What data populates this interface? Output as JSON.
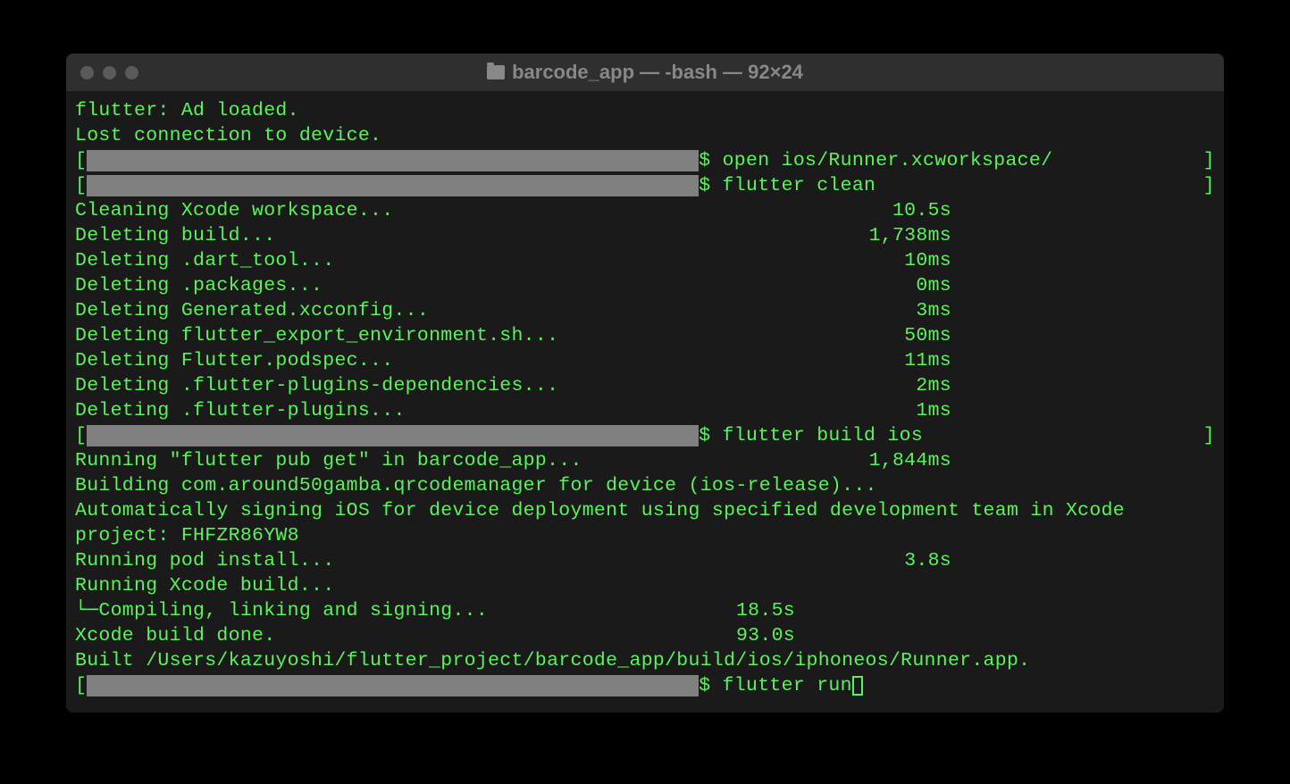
{
  "window": {
    "title": "barcode_app — -bash — 92×24"
  },
  "output": {
    "line1": "flutter: Ad loaded.",
    "line2": "Lost connection to device.",
    "prompt1_cmd": "$ open ios/Runner.xcworkspace/",
    "prompt2_cmd": "$ flutter clean",
    "clean_lines": [
      {
        "label": "Cleaning Xcode workspace...",
        "time": "10.5s"
      },
      {
        "label": "Deleting build...",
        "time": "1,738ms"
      },
      {
        "label": "Deleting .dart_tool...",
        "time": "10ms"
      },
      {
        "label": "Deleting .packages...",
        "time": "0ms"
      },
      {
        "label": "Deleting Generated.xcconfig...",
        "time": "3ms"
      },
      {
        "label": "Deleting flutter_export_environment.sh...",
        "time": "50ms"
      },
      {
        "label": "Deleting Flutter.podspec...",
        "time": "11ms"
      },
      {
        "label": "Deleting .flutter-plugins-dependencies...",
        "time": "2ms"
      },
      {
        "label": "Deleting .flutter-plugins...",
        "time": "1ms"
      }
    ],
    "prompt3_cmd": "$ flutter build ios",
    "build_line1_label": "Running \"flutter pub get\" in barcode_app...",
    "build_line1_time": "1,844ms",
    "build_line2": "Building com.around50gamba.qrcodemanager for device (ios-release)...",
    "build_line3": "Automatically signing iOS for device deployment using specified development team in Xcode",
    "build_line4": "project: FHFZR86YW8",
    "build_line5_label": "Running pod install...",
    "build_line5_time": "3.8s",
    "build_line6": "Running Xcode build...",
    "build_line7_label": " └─Compiling, linking and signing...",
    "build_line7_time": "18.5s",
    "build_line8_label": "Xcode build done.",
    "build_line8_time": "93.0s",
    "build_line9": "Built /Users/kazuyoshi/flutter_project/barcode_app/build/ios/iphoneos/Runner.app.",
    "prompt4_cmd": "$ flutter run"
  }
}
